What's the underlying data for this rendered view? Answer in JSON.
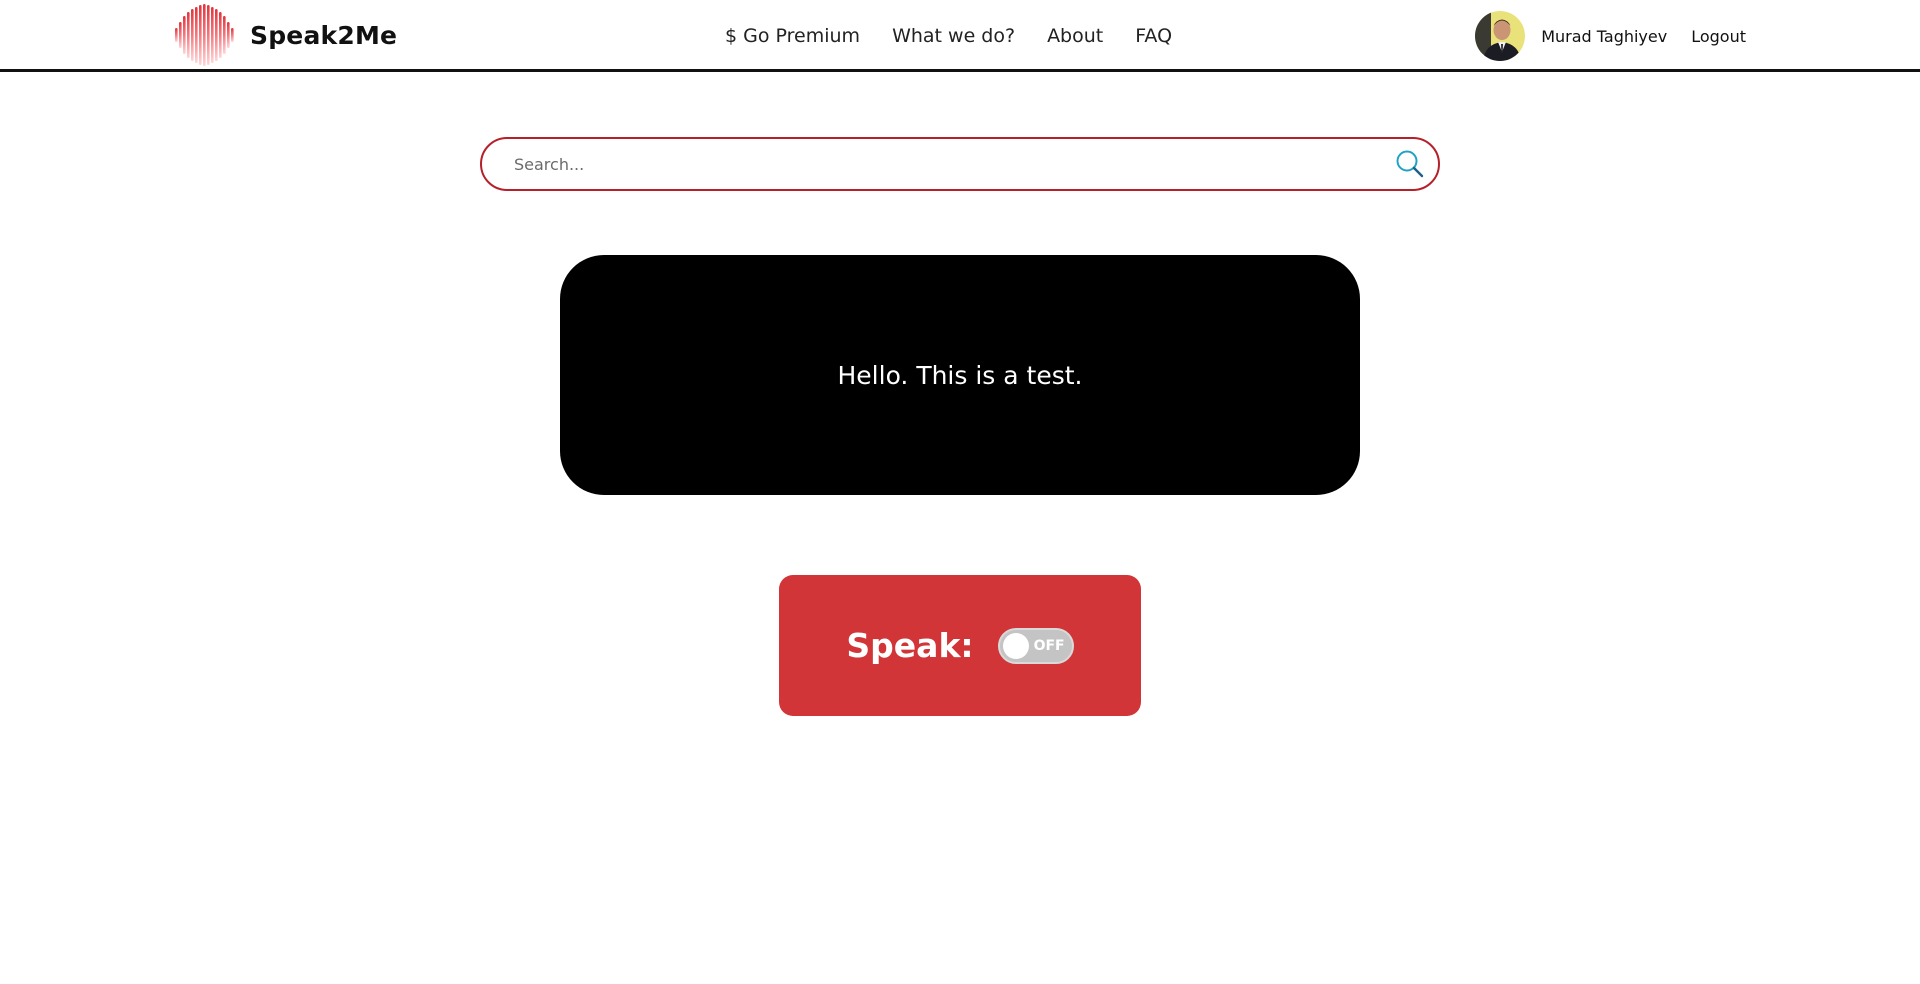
{
  "header": {
    "brand_name": "Speak2Me",
    "logo_icon": "sound-wave-icon",
    "nav": [
      {
        "label": "$ Go Premium"
      },
      {
        "label": "What we do?"
      },
      {
        "label": "About"
      },
      {
        "label": "FAQ"
      }
    ],
    "user": {
      "name": "Murad Taghiyev",
      "avatar": "user-avatar"
    },
    "logout_label": "Logout"
  },
  "search": {
    "placeholder": "Search...",
    "value": "",
    "icon": "search-icon"
  },
  "output": {
    "text": "Hello. This is a test."
  },
  "speak": {
    "label": "Speak:",
    "toggle_state": "OFF"
  },
  "colors": {
    "accent_red": "#d13537",
    "search_border": "#b5202a",
    "search_icon": "#1fa3c4",
    "output_bg": "#000000",
    "toggle_off": "#c4c4c4"
  }
}
